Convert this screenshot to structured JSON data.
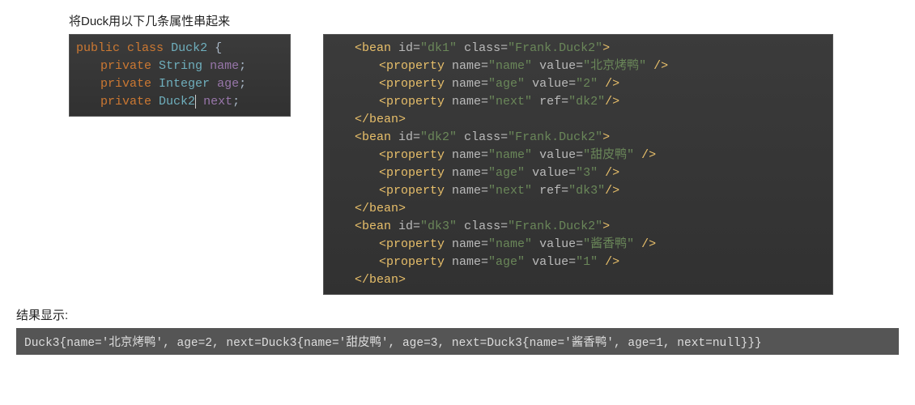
{
  "heading": "将Duck用以下几条属性串起来",
  "java": {
    "l1": {
      "kw1": "public",
      "kw2": "class",
      "cls": "Duck2",
      "brace": "{"
    },
    "l2": {
      "mod": "private",
      "type": "String",
      "name": "name"
    },
    "l3": {
      "mod": "private",
      "type": "Integer",
      "name": "age"
    },
    "l4": {
      "mod": "private",
      "type": "Duck2",
      "name": "next"
    }
  },
  "xml": {
    "b1": {
      "open": "<bean",
      "idAttr": "id=",
      "id": "\"dk1\"",
      "classAttr": "class=",
      "cls": "\"Frank.Duck2\"",
      "gt": ">"
    },
    "p1": {
      "open": "<property",
      "nameAttr": "name=",
      "name": "\"name\"",
      "valueAttr": "value=",
      "value": "\"北京烤鸭\"",
      "end": "/>"
    },
    "p2": {
      "open": "<property",
      "nameAttr": "name=",
      "name": "\"age\"",
      "valueAttr": "value=",
      "value": "\"2\"",
      "end": "/>"
    },
    "p3": {
      "open": "<property",
      "nameAttr": "name=",
      "name": "\"next\"",
      "refAttr": "ref=",
      "ref": "\"dk2\"",
      "end": "/>"
    },
    "b1c": "</bean>",
    "b2": {
      "open": "<bean",
      "idAttr": "id=",
      "id": "\"dk2\"",
      "classAttr": "class=",
      "cls": "\"Frank.Duck2\"",
      "gt": ">"
    },
    "p4": {
      "open": "<property",
      "nameAttr": "name=",
      "name": "\"name\"",
      "valueAttr": "value=",
      "value": "\"甜皮鸭\"",
      "end": "/>"
    },
    "p5": {
      "open": "<property",
      "nameAttr": "name=",
      "name": "\"age\"",
      "valueAttr": "value=",
      "value": "\"3\"",
      "end": "/>"
    },
    "p6": {
      "open": "<property",
      "nameAttr": "name=",
      "name": "\"next\"",
      "refAttr": "ref=",
      "ref": "\"dk3\"",
      "end": "/>"
    },
    "b2c": "</bean>",
    "b3": {
      "open": "<bean",
      "idAttr": "id=",
      "id": "\"dk3\"",
      "classAttr": "class=",
      "cls": "\"Frank.Duck2\"",
      "gt": ">"
    },
    "p7": {
      "open": "<property",
      "nameAttr": "name=",
      "name": "\"name\"",
      "valueAttr": "value=",
      "value": "\"酱香鸭\"",
      "end": "/>"
    },
    "p8": {
      "open": "<property",
      "nameAttr": "name=",
      "name": "\"age\"",
      "valueAttr": "value=",
      "value": "\"1\"",
      "end": "/>"
    },
    "b3c": "</bean>"
  },
  "resultLabel": "结果显示:",
  "resultText": "Duck3{name='北京烤鸭', age=2, next=Duck3{name='甜皮鸭', age=3, next=Duck3{name='酱香鸭', age=1, next=null}}}"
}
